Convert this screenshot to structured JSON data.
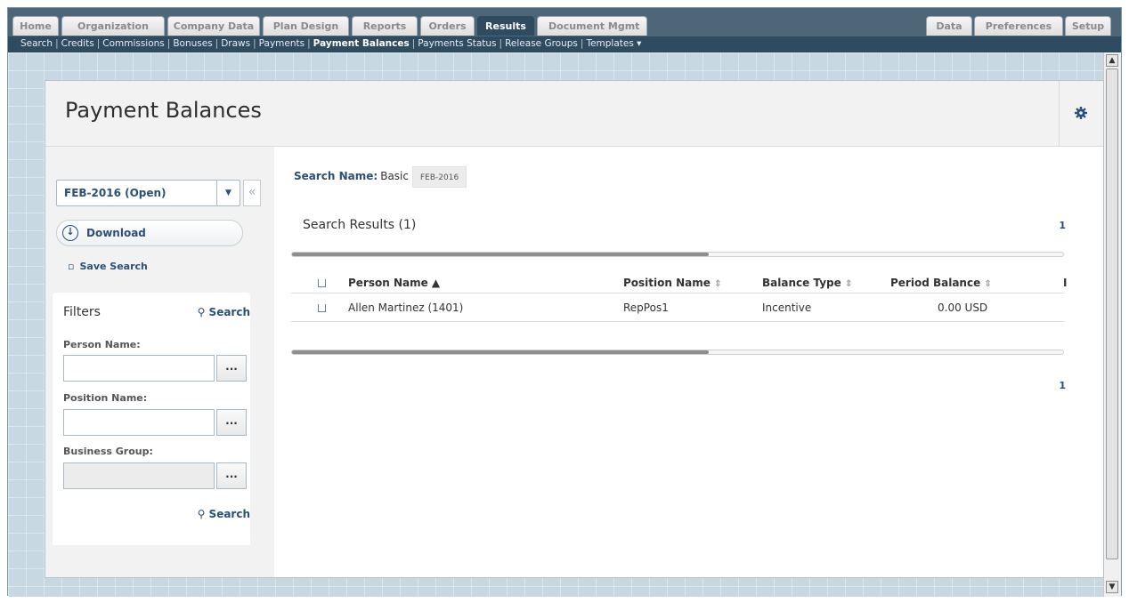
{
  "tabs": [
    {
      "label": "Home",
      "active": false
    },
    {
      "label": "Organization",
      "active": false
    },
    {
      "label": "Company Data",
      "active": false
    },
    {
      "label": "Plan Design",
      "active": false
    },
    {
      "label": "Reports",
      "active": false
    },
    {
      "label": "Orders",
      "active": false
    },
    {
      "label": "Results",
      "active": true
    },
    {
      "label": "Document Mgmt",
      "active": false
    }
  ],
  "right_tabs": [
    {
      "label": "Data"
    },
    {
      "label": "Preferences"
    },
    {
      "label": "Setup"
    }
  ],
  "subnav": {
    "items": [
      {
        "label": "Search",
        "active": false
      },
      {
        "label": "Credits",
        "active": false
      },
      {
        "label": "Commissions",
        "active": false
      },
      {
        "label": "Bonuses",
        "active": false
      },
      {
        "label": "Draws",
        "active": false
      },
      {
        "label": "Payments",
        "active": false
      },
      {
        "label": "Payment Balances",
        "active": true
      },
      {
        "label": "Payments Status",
        "active": false
      },
      {
        "label": "Release Groups",
        "active": false
      },
      {
        "label": "Templates ▾",
        "active": false
      }
    ]
  },
  "page": {
    "title": "Payment Balances",
    "settings_icon": "gear-icon"
  },
  "sidebar": {
    "period": "FEB-2016 (Open)",
    "collapse_glyph": "«",
    "download_label": "Download",
    "save_search_label": "Save Search",
    "filters": {
      "title": "Filters",
      "search_label": "Search",
      "person_name_label": "Person Name:",
      "person_name_value": "",
      "position_name_label": "Position Name:",
      "position_name_value": "",
      "business_group_label": "Business Group:",
      "business_group_value": "",
      "ellipsis": "...",
      "bottom_search_label": "Search"
    }
  },
  "main": {
    "search_name_label": "Search Name:",
    "search_name_value": "Basic",
    "search_chip": "FEB-2016",
    "results_title": "Search Results (1)",
    "pager_top": "1",
    "pager_bottom": "1",
    "scroll_fraction": 0.54,
    "columns": {
      "person_name": "Person Name ▲",
      "position_name": "Position Name",
      "balance_type": "Balance Type",
      "period_balance": "Period Balance",
      "next": "I"
    },
    "rows": [
      {
        "person_name": "Allen Martinez (1401)",
        "position_name": "RepPos1",
        "balance_type": "Incentive",
        "period_balance": "0.00 USD"
      }
    ]
  }
}
